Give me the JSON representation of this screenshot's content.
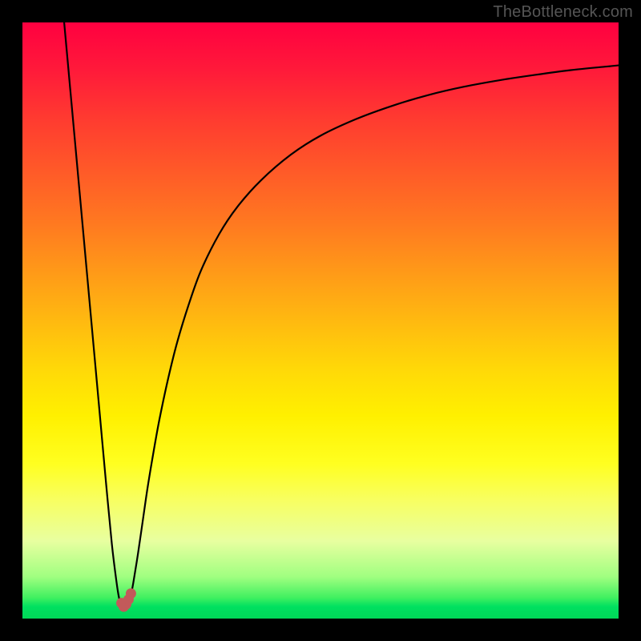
{
  "attribution": "TheBottleneck.com",
  "chart_data": {
    "type": "line",
    "title": "",
    "xlabel": "",
    "ylabel": "",
    "xlim": [
      0,
      100
    ],
    "ylim": [
      0,
      100
    ],
    "grid": false,
    "legend": false,
    "background_gradient": {
      "direction": "vertical",
      "stops": [
        {
          "pos": 0.0,
          "color": "#ff0040"
        },
        {
          "pos": 0.5,
          "color": "#ffb910"
        },
        {
          "pos": 0.74,
          "color": "#ffff20"
        },
        {
          "pos": 1.0,
          "color": "#00d858"
        }
      ]
    },
    "series": [
      {
        "name": "bottleneck-curve",
        "color": "#000000",
        "x": [
          7.0,
          8.0,
          9.0,
          10.0,
          11.0,
          12.0,
          13.0,
          14.0,
          15.0,
          15.8,
          16.2,
          16.6,
          17.0,
          17.4,
          17.8,
          18.2,
          18.6,
          19.4,
          20.2,
          21.0,
          22.0,
          23.0,
          24.5,
          26.0,
          28.0,
          30.0,
          33.0,
          36.0,
          40.0,
          45.0,
          50.0,
          56.0,
          62.0,
          68.0,
          74.0,
          80.0,
          86.0,
          92.0,
          98.0,
          100.0
        ],
        "values": [
          100,
          89.0,
          78.0,
          67.0,
          56.0,
          45.0,
          34.0,
          23.0,
          12.5,
          6.0,
          3.5,
          2.2,
          1.8,
          2.0,
          2.8,
          4.0,
          6.0,
          11.0,
          16.5,
          22.0,
          28.0,
          33.5,
          40.5,
          46.5,
          53.0,
          58.5,
          64.5,
          69.0,
          73.5,
          77.8,
          81.0,
          83.8,
          86.0,
          87.8,
          89.2,
          90.3,
          91.2,
          92.0,
          92.6,
          92.8
        ]
      },
      {
        "name": "marker-dip",
        "color": "#c25a5a",
        "marker_x": [
          16.6,
          17.0,
          17.4,
          17.8,
          18.2
        ],
        "marker_y": [
          2.6,
          2.0,
          2.4,
          3.2,
          4.2
        ]
      }
    ]
  }
}
